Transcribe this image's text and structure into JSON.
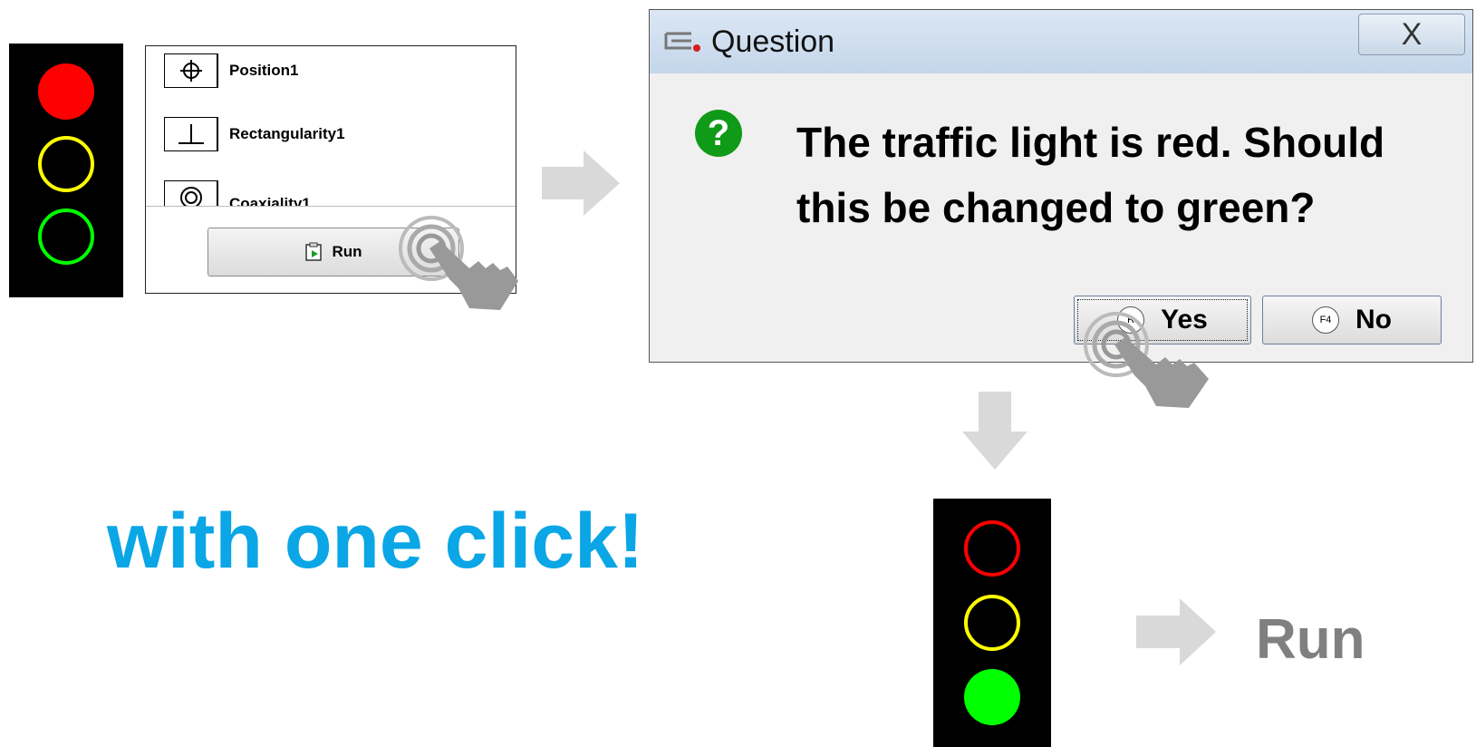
{
  "colors": {
    "lamp_red": "#ff0000",
    "lamp_yellow": "#ffff00",
    "lamp_green": "#00ff00",
    "slogan": "#0aa6e6",
    "arrow": "#d9d9d9",
    "question_icon": "#0f9a18"
  },
  "traffic_light_before": {
    "red": "on",
    "yellow": "off",
    "green": "off"
  },
  "traffic_light_after": {
    "red": "off",
    "yellow": "off",
    "green": "on"
  },
  "feature_list": {
    "items": [
      {
        "label": "Position1",
        "icon": "position-symbol-icon"
      },
      {
        "label": "Rectangularity1",
        "icon": "rectangularity-symbol-icon"
      },
      {
        "label": "Coaxiality1",
        "icon": "coaxiality-symbol-icon"
      }
    ],
    "run_button": {
      "label": "Run",
      "icon": "run-program-icon"
    }
  },
  "dialog": {
    "title": "Question",
    "close_label": "X",
    "message_line1": "The traffic light is red. Should",
    "message_line2": "this be changed to green?",
    "yes_label": "Yes",
    "yes_key": "R",
    "no_label": "No",
    "no_key": "F4"
  },
  "slogan": "with one click!",
  "result_label": "Run"
}
